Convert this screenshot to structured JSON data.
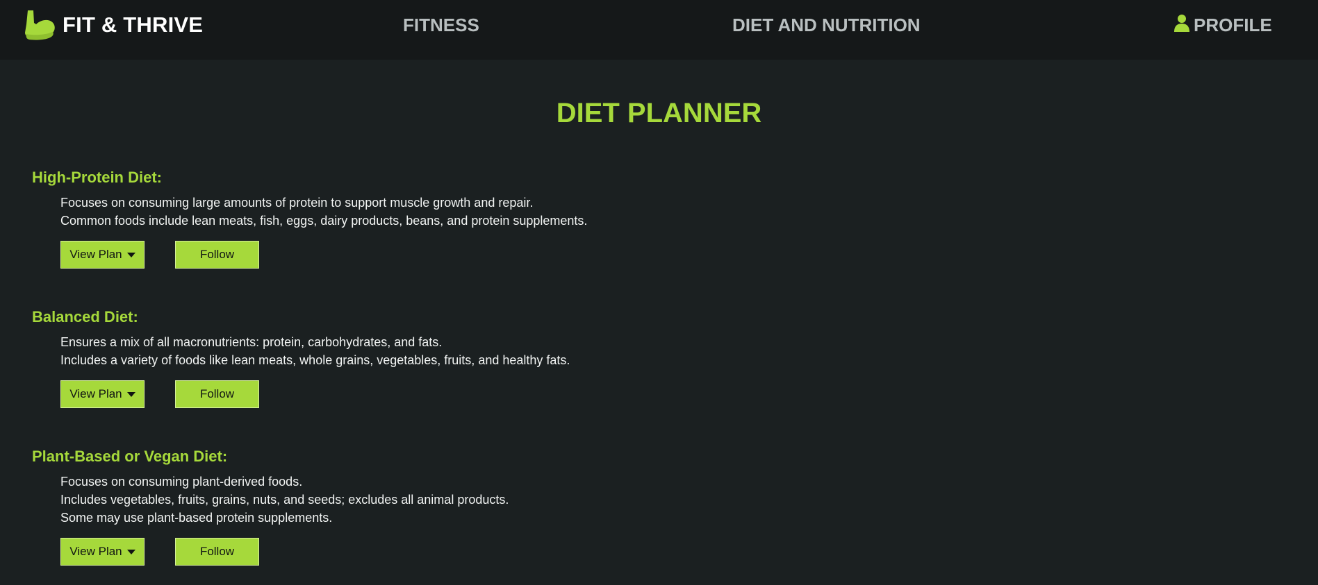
{
  "nav": {
    "brand": "FIT & THRIVE",
    "brand_icon": "flexed-arm-icon",
    "fitness": "FITNESS",
    "diet": "DIET AND NUTRITION",
    "profile": "PROFILE",
    "profile_icon": "user-icon"
  },
  "colors": {
    "accent": "#a6d93b",
    "background": "#1b2021",
    "navbar": "#151819",
    "nav_text": "#b9bfc0",
    "body_text": "#f2f4f3"
  },
  "page": {
    "title": "DIET PLANNER"
  },
  "diets": [
    {
      "title": "High-Protein Diet:",
      "lines": [
        "Focuses on consuming large amounts of protein to support muscle growth and repair.",
        "Common foods include lean meats, fish, eggs, dairy products, beans, and protein supplements."
      ],
      "view_label": "View Plan",
      "follow_label": "Follow"
    },
    {
      "title": "Balanced Diet:",
      "lines": [
        "Ensures a mix of all macronutrients: protein, carbohydrates, and fats.",
        "Includes a variety of foods like lean meats, whole grains, vegetables, fruits, and healthy fats."
      ],
      "view_label": "View Plan",
      "follow_label": "Follow"
    },
    {
      "title": "Plant-Based or Vegan Diet:",
      "lines": [
        "Focuses on consuming plant-derived foods.",
        "Includes vegetables, fruits, grains, nuts, and seeds; excludes all animal products.",
        "Some may use plant-based protein supplements."
      ],
      "view_label": "View Plan",
      "follow_label": "Follow"
    }
  ]
}
